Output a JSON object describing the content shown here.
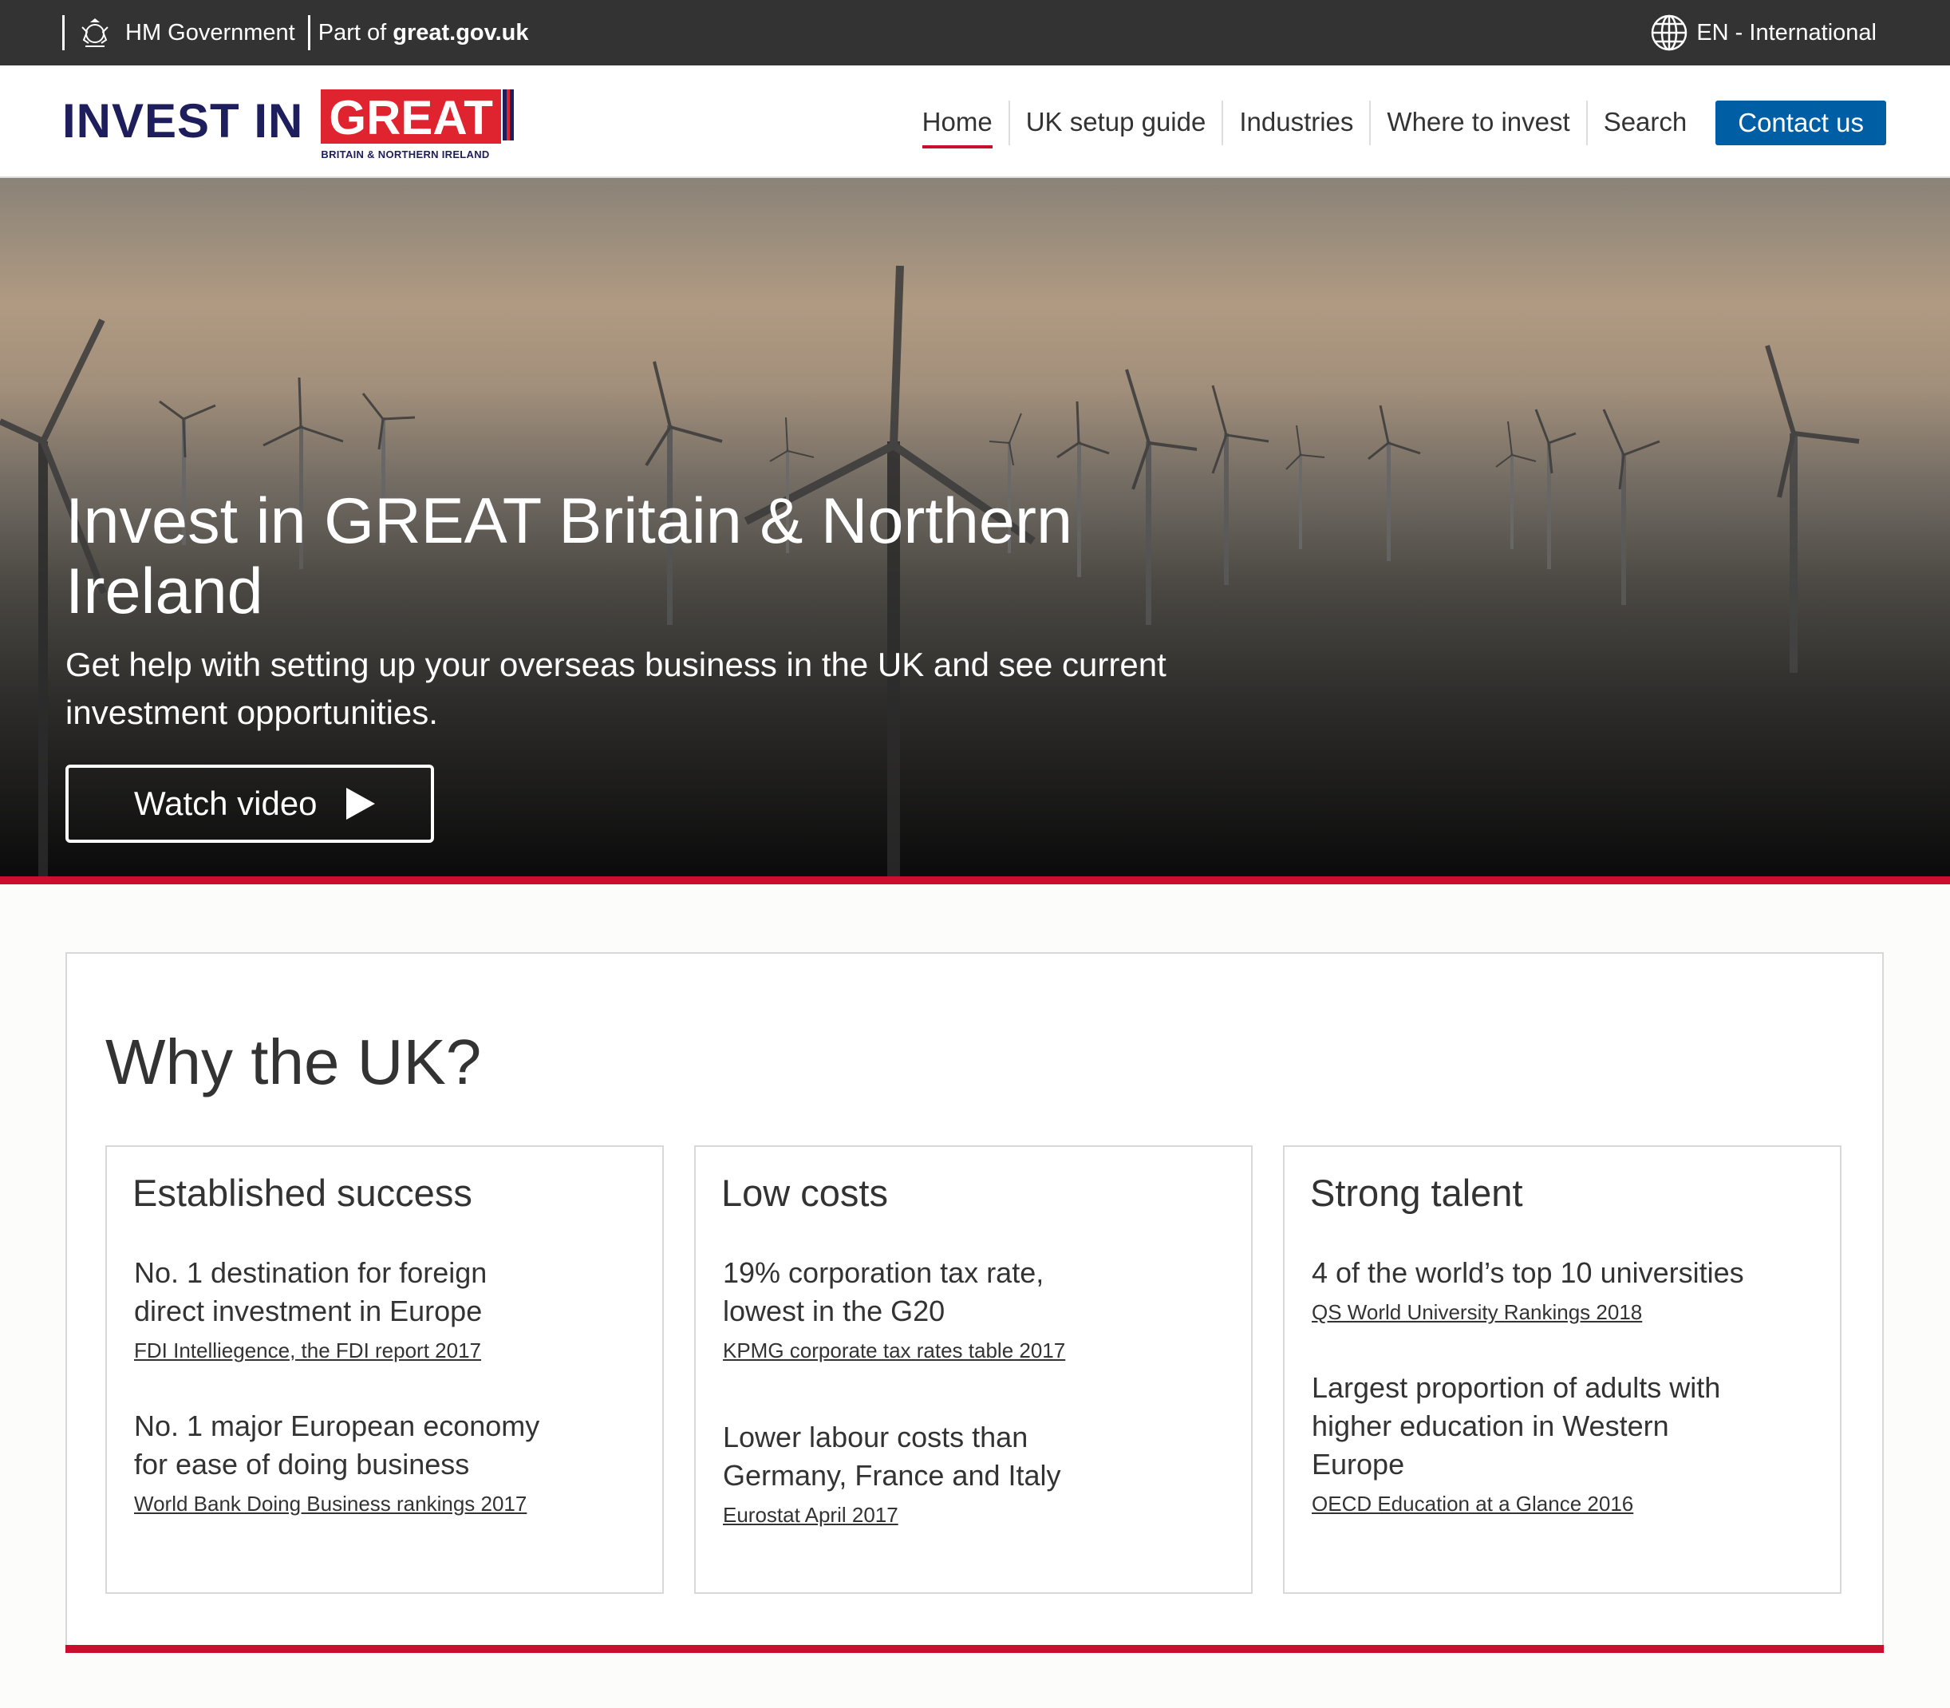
{
  "govbar": {
    "hm_government": "HM Government",
    "part_of_prefix": "Part of ",
    "part_of_site": "great.gov.uk",
    "language": "EN - International"
  },
  "header": {
    "logo_invest": "INVEST IN",
    "logo_great": "GREAT",
    "logo_sub": "BRITAIN & NORTHERN IRELAND",
    "nav": [
      "Home",
      "UK setup guide",
      "Industries",
      "Where to invest",
      "Search"
    ],
    "contact": "Contact us"
  },
  "hero": {
    "title": "Invest in GREAT Britain & Northern Ireland",
    "subtitle": "Get help with setting up your overseas business in the UK and see current investment opportunities.",
    "watch_video": "Watch video"
  },
  "why": {
    "heading": "Why the UK?",
    "cards": [
      {
        "title": "Established success",
        "stats": [
          {
            "text": "No. 1 destination for foreign direct investment in Europe",
            "source": "FDI Intelliegence, the FDI report 2017"
          },
          {
            "text": "No. 1 major European economy for ease of doing business",
            "source": "World Bank Doing Business rankings 2017"
          }
        ]
      },
      {
        "title": "Low costs",
        "stats": [
          {
            "text": "19% corporation tax rate, lowest in the G20",
            "source": "KPMG corporate tax rates table 2017"
          },
          {
            "text": "Lower labour costs than Germany, France and Italy",
            "source": "Eurostat April 2017"
          }
        ]
      },
      {
        "title": "Strong talent",
        "stats": [
          {
            "text": "4 of the world’s top 10 universities",
            "source": "QS World University Rankings 2018"
          },
          {
            "text": "Largest proportion of adults with  higher education in Western Europe",
            "source": "OECD Education at a Glance 2016"
          }
        ]
      }
    ]
  },
  "colors": {
    "govbar": "#333333",
    "brand_red": "#c8102e",
    "brand_blue": "#005ea5",
    "logo_navy": "#1f1e5c"
  }
}
